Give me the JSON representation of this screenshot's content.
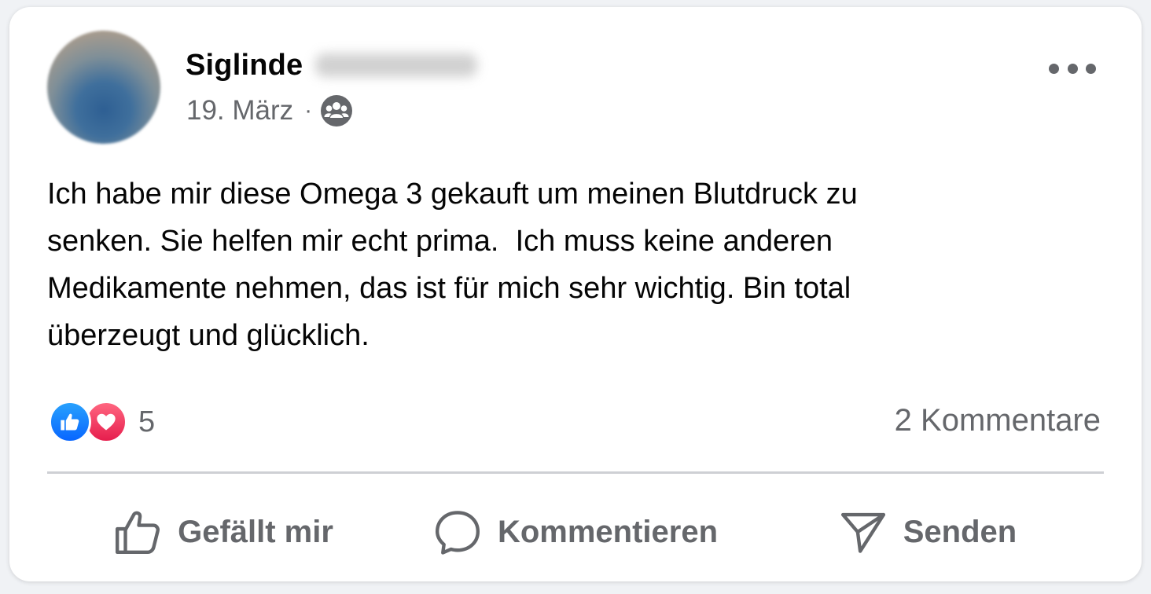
{
  "post": {
    "author_first_name": "Siglinde",
    "date": "19. März",
    "separator": "·",
    "audience_icon": "group-icon",
    "more_icon": "more-options-icon",
    "text": "Ich habe mir diese Omega 3 gekauft um meinen Blutdruck zu\nsenken. Sie helfen mir echt prima.  Ich muss keine anderen\nMedikamente nehmen, das ist für mich sehr wichtig. Bin total\nüberzeugt und glücklich."
  },
  "stats": {
    "reaction_icons": [
      "like-reaction-icon",
      "love-reaction-icon"
    ],
    "reaction_count": "5",
    "comments": "2 Kommentare"
  },
  "actions": {
    "like_label": "Gefällt mir",
    "comment_label": "Kommentieren",
    "send_label": "Senden"
  },
  "colors": {
    "like_blue": "#0866ff",
    "love_red": "#e61e4d",
    "secondary_text": "#65676b",
    "primary_text": "#050505"
  }
}
